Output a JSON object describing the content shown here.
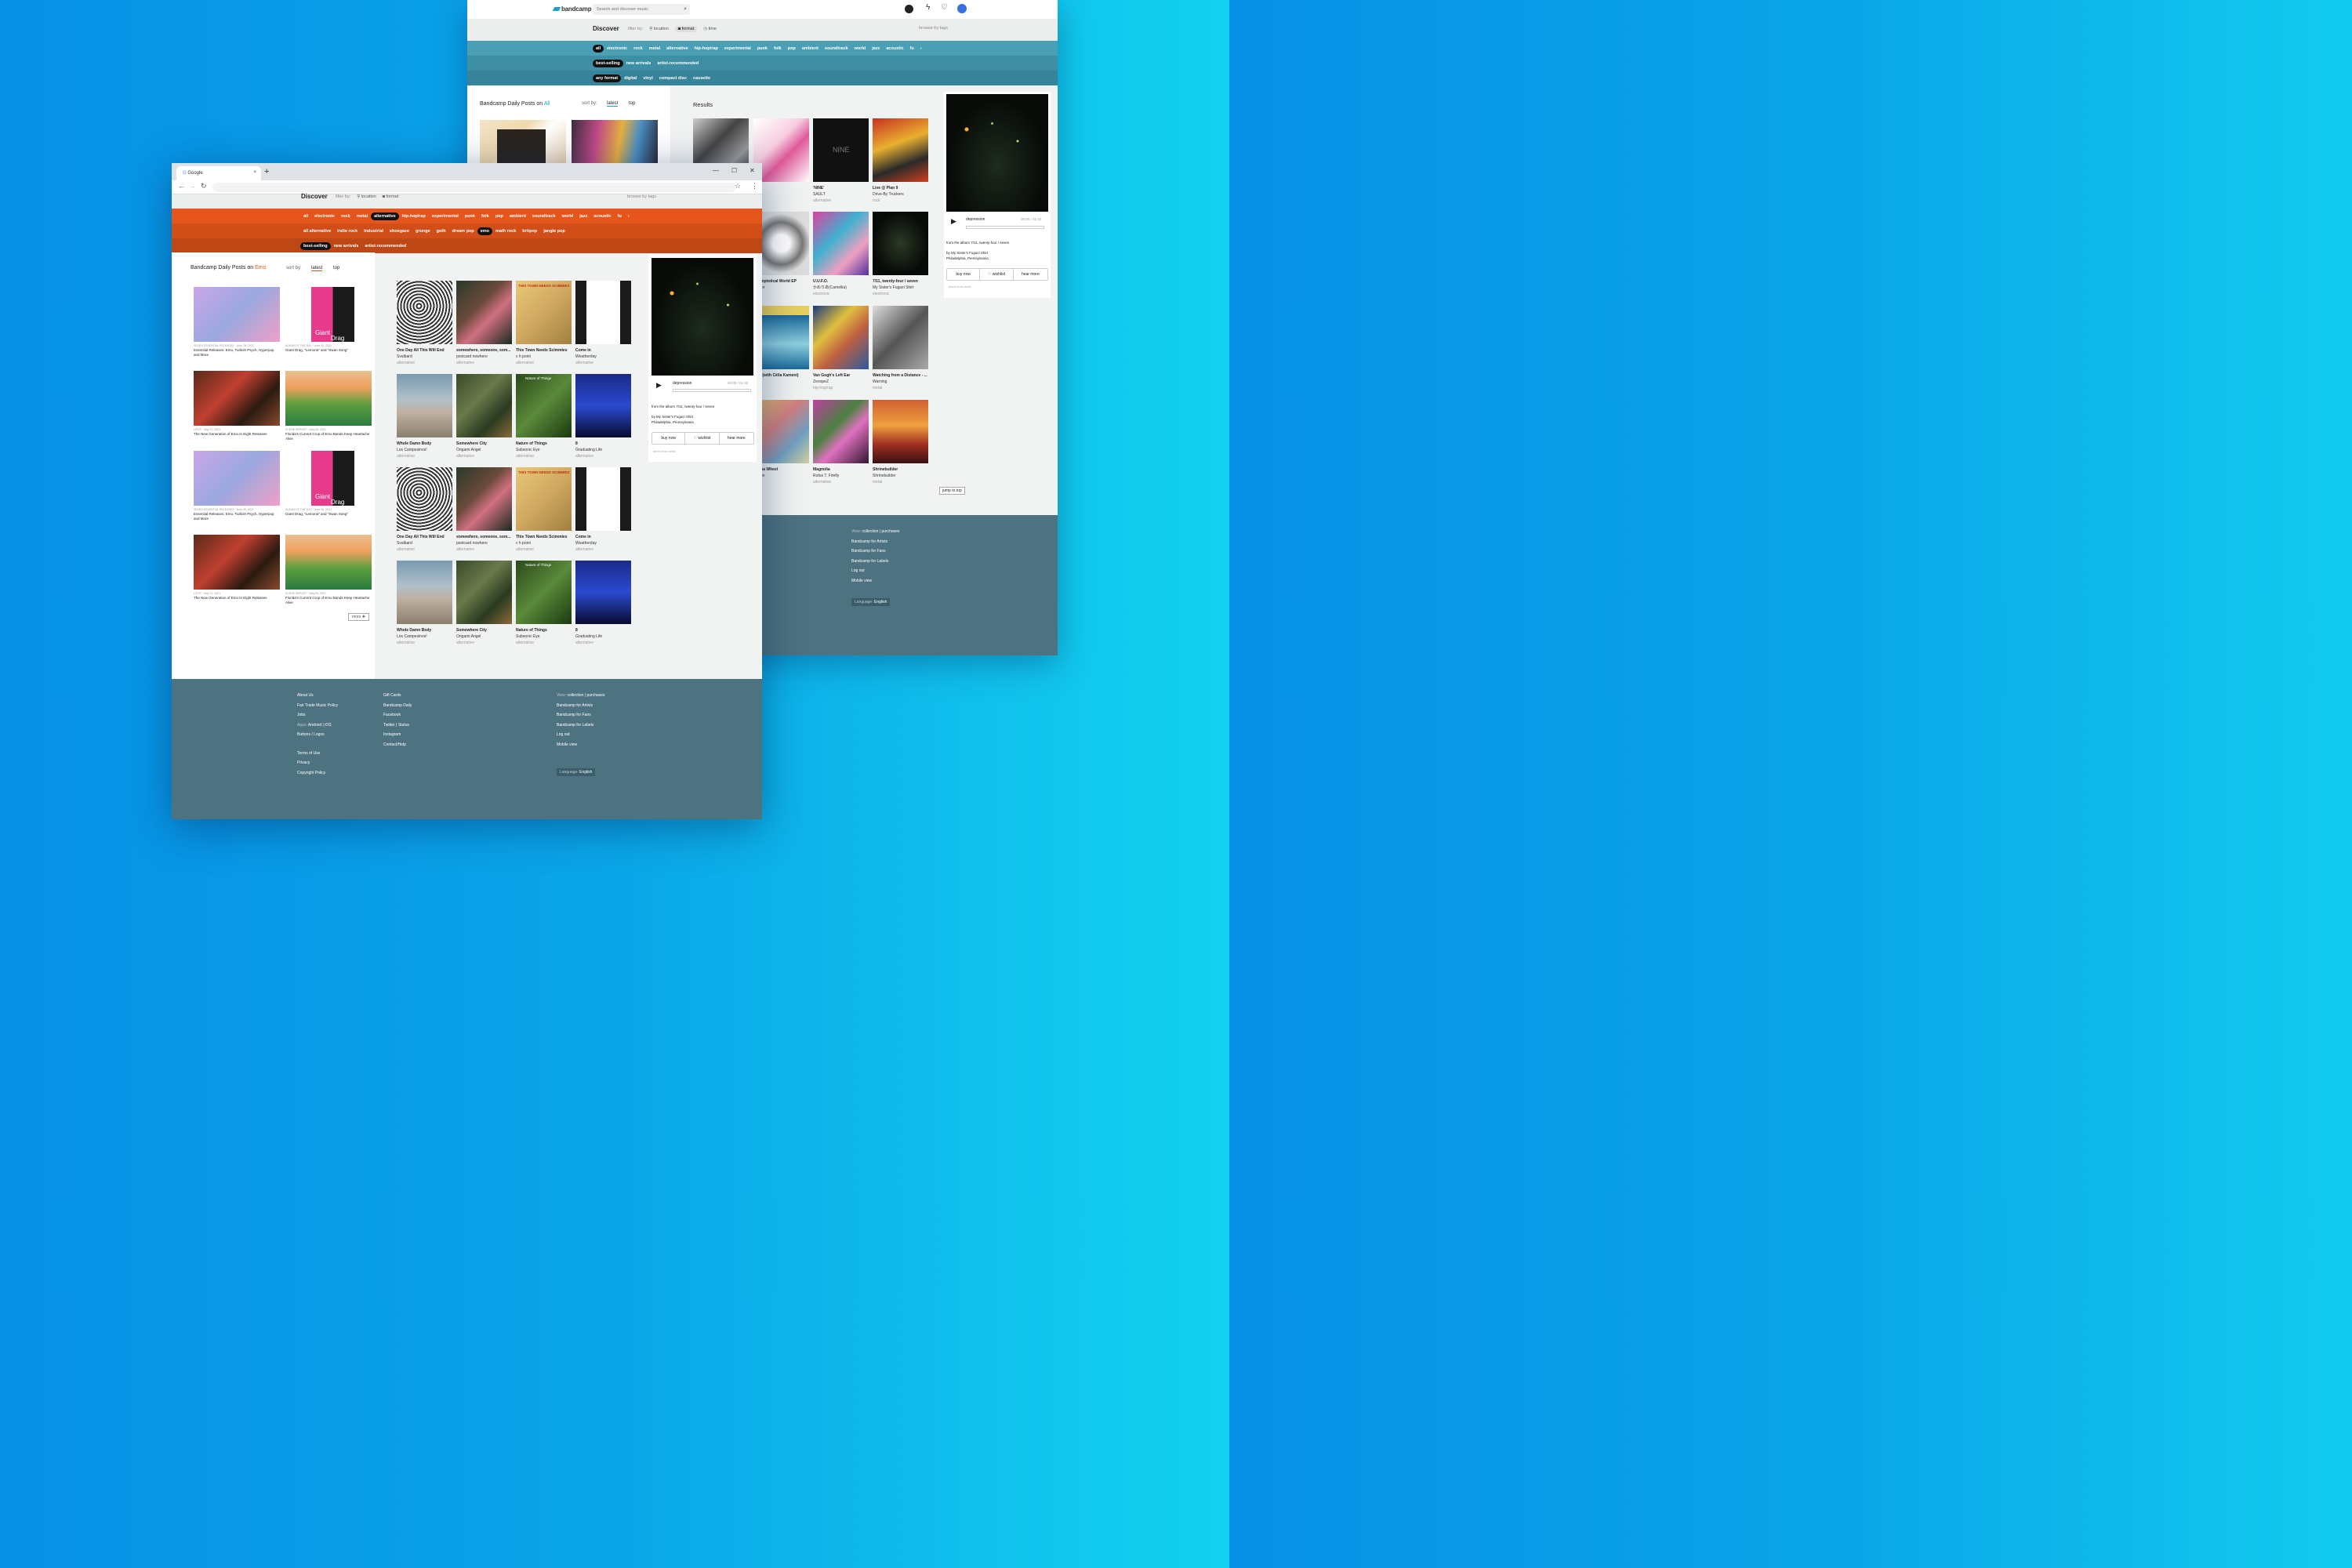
{
  "back": {
    "logo": "bandcamp",
    "search_placeholder": "Search and discover music",
    "discover": "Discover",
    "filter_by": "filter by:",
    "location": "location",
    "format": "format",
    "time": "time",
    "browse": "browse by tags",
    "genres": [
      "all",
      "electronic",
      "rock",
      "metal",
      "alternative",
      "hip-hop/rap",
      "experimental",
      "punk",
      "folk",
      "pop",
      "ambient",
      "soundtrack",
      "world",
      "jazz",
      "acoustic",
      "fu"
    ],
    "sorts": [
      "best-selling",
      "new arrivals",
      "artist-recommended"
    ],
    "formats": [
      "any format",
      "digital",
      "vinyl",
      "compact disc",
      "cassette"
    ],
    "daily_title": "Bandcamp Daily Posts on",
    "daily_tag": "All",
    "sort_by": "sort by:",
    "latest": "latest",
    "top": "top",
    "results": "Results",
    "items": [
      {
        "t": "",
        "a": "",
        "g": ""
      },
      {
        "t": "ay",
        "a": "Elite",
        "g": "onic"
      },
      {
        "t": "'NINE'",
        "a": "SAULT",
        "g": "alternative"
      },
      {
        "t": "Live @ Plan 9",
        "a": "Drive-By Truckers",
        "g": "rock"
      },
      {
        "t": "Asymptotical World EP",
        "a": "Tumor",
        "g": ""
      },
      {
        "t": "U.U.F.O.",
        "a": "かめりあ(Camellia)",
        "g": "electronic"
      },
      {
        "t": "7/11, twenty-four / seven",
        "a": "My Sister's Fugazi Shirt",
        "g": "electronic"
      },
      {
        "t": "chiá (with Célia Kameni)",
        "a": "mea",
        "g": ""
      },
      {
        "t": "Van Gogh's Left Ear",
        "a": "ZeoopeZ",
        "g": "hip-hop/rap"
      },
      {
        "t": "Watching from a Distance - ...",
        "a": "Warning",
        "g": "metal"
      },
      {
        "t": "harma Wheel",
        "a": "n Rain",
        "g": ""
      },
      {
        "t": "Magnolia",
        "a": "Rufus T. Firefly",
        "g": "alternative"
      },
      {
        "t": "Shrinebuilder",
        "a": "Shrinebuilder",
        "g": "metal"
      }
    ],
    "nine": "NINE",
    "track": "depression",
    "time_read": "00:00 / 01:32",
    "from_album": "from the album 7/11, twenty-four / seven",
    "by": "by My Sister's Fugazi Shirt",
    "place": "Philadelphia, Pennsylvania",
    "buy": "buy now",
    "wish": "♡ wishlist",
    "hear": "hear more",
    "direct": "direct from artist",
    "jump": "jump to top",
    "f_view": "View:",
    "f_collection": "collection",
    "f_purchases": "purchases",
    "f_links": [
      "Bandcamp for Artists",
      "Bandcamp for Fans",
      "Bandcamp for Labels",
      "Log out",
      "Mobile view"
    ],
    "f_lang": "Language:",
    "f_english": "English"
  },
  "front": {
    "tab_title": "Google",
    "discover": "Discover",
    "filter_by": "filter by:",
    "location": "location",
    "format": "format",
    "browse": "browse by tags",
    "genres": [
      "all",
      "electronic",
      "rock",
      "metal",
      "alternative",
      "hip-hop/rap",
      "experimental",
      "punk",
      "folk",
      "pop",
      "ambient",
      "soundtrack",
      "world",
      "jazz",
      "acoustic",
      "fu"
    ],
    "subgenres": [
      "all alternative",
      "indie rock",
      "industrial",
      "shoegaze",
      "grunge",
      "goth",
      "dream pop",
      "emo",
      "math rock",
      "britpop",
      "jangle pop"
    ],
    "sorts": [
      "best-selling",
      "new arrivals",
      "artist-recommended"
    ],
    "daily_title": "Bandcamp Daily Posts on",
    "daily_tag": "Emo",
    "sort_by": "sort by:",
    "latest": "latest",
    "top": "top",
    "giant": "Giant",
    "drag": "Drag",
    "posts": [
      {
        "k": "SEVEN ESSENTIAL RELEASES · June 25, 2021",
        "t": "Essential Releases: Emo, Turkish Psych, Hyperpop and More"
      },
      {
        "k": "ALBUM OF THE DAY · June 30, 2021",
        "t": "Giant Drag, \"Lemona\" and \"Swan Song\""
      },
      {
        "k": "LISTS · May 21, 2021",
        "t": "The New Generation of Emo In Eight Releases"
      },
      {
        "k": "SCENE REPORT · May 06, 2021",
        "t": "Florida's Current Crop of Emo Bands Keep Heartache Alive"
      },
      {
        "k": "SEVEN ESSENTIAL RELEASES · June 25, 2021",
        "t": "Essential Releases: Emo, Turkish Psych, Hyperpop and More"
      },
      {
        "k": "ALBUM OF THE DAY · June 30, 2021",
        "t": "Giant Drag, \"Lemona\" and \"Swan Song\""
      },
      {
        "k": "LISTS · May 21, 2021",
        "t": "The New Generation of Emo In Eight Releases"
      },
      {
        "k": "SCENE REPORT · May 06, 2021",
        "t": "Florida's Current Crop of Emo Bands Keep Heartache Alive"
      }
    ],
    "more": "more",
    "items": [
      {
        "t": "One Day All This Will End",
        "a": "Svalbard",
        "g": "alternative"
      },
      {
        "t": "somewhere, someone, som...",
        "a": "postcard nowhere",
        "g": "alternative"
      },
      {
        "t": "This Town Needs Scimmies",
        "a": "c h point",
        "g": "alternative"
      },
      {
        "t": "Come in",
        "a": "Weatherday",
        "g": "alternative"
      },
      {
        "t": "Whole Damn Body",
        "a": "Los Campesinos!",
        "g": "alternative"
      },
      {
        "t": "Somewhere City",
        "a": "Origami Angel",
        "g": "alternative"
      },
      {
        "t": "Nature of Things",
        "a": "Subsonic Eye",
        "g": "alternative"
      },
      {
        "t": "8",
        "a": "Graduating Life",
        "g": "alternative"
      },
      {
        "t": "One Day All This Will End",
        "a": "Svalbard",
        "g": "alternative"
      },
      {
        "t": "somewhere, someone, som...",
        "a": "postcard nowhere",
        "g": "alternative"
      },
      {
        "t": "This Town Needs Scimmies",
        "a": "c h point",
        "g": "alternative"
      },
      {
        "t": "Come in",
        "a": "Weatherday",
        "g": "alternative"
      },
      {
        "t": "Whole Damn Body",
        "a": "Los Campesinos!",
        "g": "alternative"
      },
      {
        "t": "Somewhere City",
        "a": "Origami Angel",
        "g": "alternative"
      },
      {
        "t": "Nature of Things",
        "a": "Subsonic Eye",
        "g": "alternative"
      },
      {
        "t": "8",
        "a": "Graduating Life",
        "g": "alternative"
      }
    ],
    "cover_this_town": "THIS TOWN NEEDS SCIMMIES",
    "cover_nature": "Nature of Things",
    "track": "depression",
    "time_read": "00:00 / 01:32",
    "from_album": "from the album 7/11, twenty-four / seven",
    "by": "by My Sister's Fugazi Shirt",
    "place": "Philadelphia, Pennsylvania",
    "buy": "buy now",
    "wish": "♡ wishlist",
    "hear": "hear more",
    "direct": "direct from artist",
    "f_col1": [
      "About Us",
      "Fair Trade Music Policy",
      "Jobs"
    ],
    "f_apps": "Apps:",
    "f_android": "Android",
    "f_ios": "iOS",
    "f_buttons": "Buttons / Logos",
    "f_legal": [
      "Terms of Use",
      "Privacy",
      "Copyright Policy"
    ],
    "f_col2": [
      "Gift Cards",
      "Bandcamp Daily",
      "Facebook"
    ],
    "f_twitter": "Twitter",
    "f_status": "Status",
    "f_col2b": [
      "Instagram",
      "Contact/Help"
    ],
    "f_view": "View:",
    "f_collection": "collection",
    "f_purchases": "purchases",
    "f_links": [
      "Bandcamp for Artists",
      "Bandcamp for Fans",
      "Bandcamp for Labels",
      "Log out",
      "Mobile view"
    ],
    "f_lang": "Language:",
    "f_english": "English"
  },
  "colors": {
    "back_band1": "#4a9fb5",
    "back_band2": "#3e8fa4",
    "back_band3": "#37839a",
    "front_band1": "#e6561c",
    "front_band2": "#d24e19",
    "front_band3": "#be4716",
    "footer": "#4d7280",
    "accent": "#1da0c3"
  }
}
